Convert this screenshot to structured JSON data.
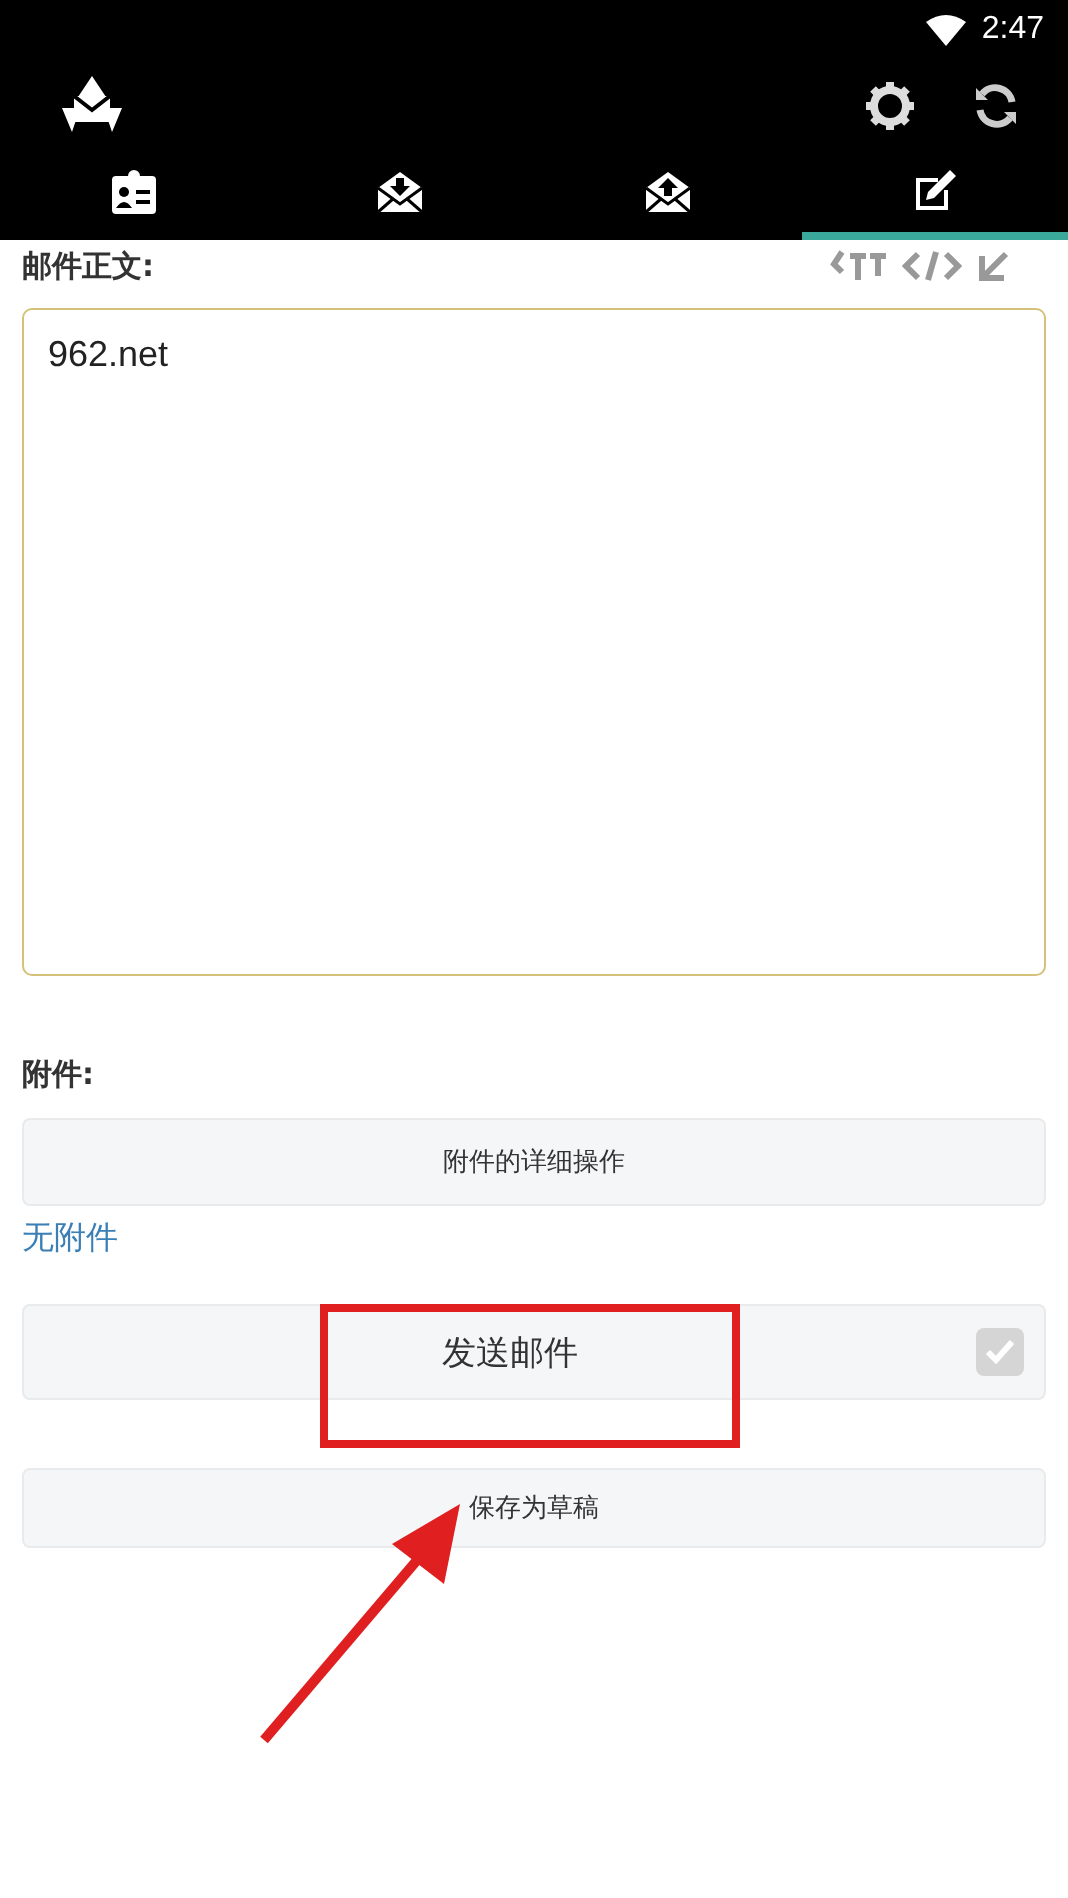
{
  "status_bar": {
    "time": "2:47"
  },
  "tabs": [
    {
      "kind": "contacts",
      "selected": false
    },
    {
      "kind": "inbox",
      "selected": false
    },
    {
      "kind": "outbox",
      "selected": false
    },
    {
      "kind": "compose",
      "selected": true
    }
  ],
  "body": {
    "label": "邮件正文:",
    "value": "962.net"
  },
  "attachments": {
    "label": "附件:",
    "details_button": "附件的详细操作",
    "status": "无附件"
  },
  "send": {
    "label": "发送邮件",
    "checked": true
  },
  "save_button": "保存为草稿"
}
